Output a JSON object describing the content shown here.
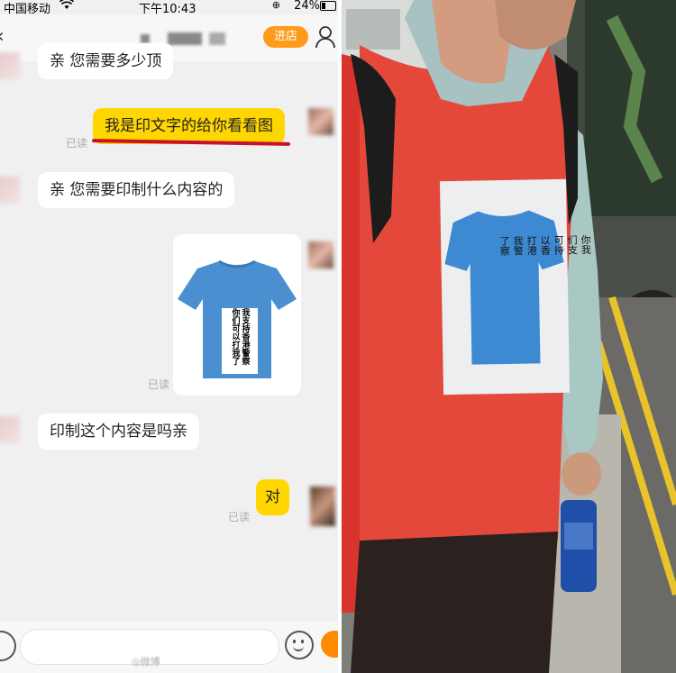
{
  "status_bar": {
    "carrier": "中国移动",
    "time": "下午10:43",
    "battery": "24%"
  },
  "header": {
    "shop_button": "进店"
  },
  "messages": [
    {
      "side": "in",
      "text": "亲 您需要多少顶"
    },
    {
      "side": "out",
      "text": "我是印文字的给你看看图",
      "read": "已读"
    },
    {
      "side": "in",
      "text": "亲 您需要印制什么内容的"
    },
    {
      "side": "out",
      "type": "image",
      "read": "已读"
    },
    {
      "side": "in",
      "text": "印制这个内容是吗亲"
    },
    {
      "side": "out",
      "text": "对",
      "read": "已读"
    }
  ],
  "shirt_image_text": {
    "line1": "我支持香港警察",
    "line2": "你们可以打我了"
  },
  "photo": {
    "sign_text": [
      "你我",
      "们支",
      "可持",
      "以香",
      "打港",
      "我警",
      "了察"
    ]
  },
  "colors": {
    "accent": "#ff9a1a",
    "outgoing_bubble": "#ffd600",
    "underline": "#c8102e",
    "shirt_blue": "#4a90d0",
    "red_shirt": "#e4483a"
  },
  "icons": [
    "wifi-icon",
    "battery-icon",
    "back-chevron-icon",
    "user-icon",
    "voice-icon",
    "emoji-icon",
    "plus-icon"
  ]
}
